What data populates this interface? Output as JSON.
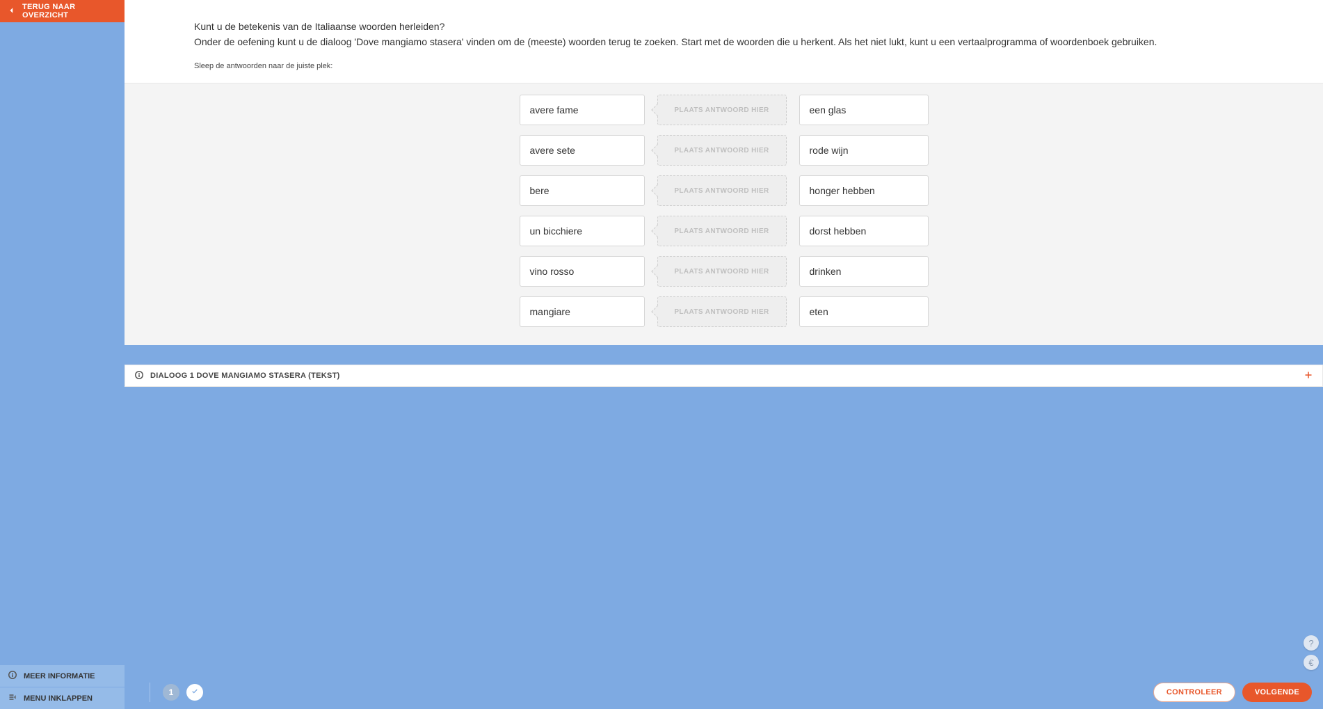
{
  "sidebar": {
    "back_label": "TERUG NAAR OVERZICHT",
    "more_info_label": "MEER INFORMATIE",
    "collapse_label": "MENU INKLAPPEN"
  },
  "intro": {
    "line1": "Kunt u de betekenis van de Italiaanse woorden herleiden?",
    "line2": "Onder de oefening kunt u de dialoog 'Dove mangiamo stasera' vinden om de (meeste) woorden terug te zoeken. Start met de woorden die u herkent. Als het niet lukt, kunt u een vertaalprogramma of woordenboek gebruiken.",
    "hint": "Sleep de antwoorden naar de juiste plek:"
  },
  "exercise": {
    "drop_placeholder": "PLAATS ANTWOORD HIER",
    "rows": [
      {
        "source": "avere fame",
        "answer": "een glas"
      },
      {
        "source": "avere sete",
        "answer": "rode wijn"
      },
      {
        "source": "bere",
        "answer": "honger hebben"
      },
      {
        "source": "un bicchiere",
        "answer": "dorst hebben"
      },
      {
        "source": "vino rosso",
        "answer": "drinken"
      },
      {
        "source": "mangiare",
        "answer": "eten"
      }
    ]
  },
  "accordion": {
    "title": "DIALOOG 1 DOVE MANGIAMO STASERA (TEKST)"
  },
  "footer": {
    "step_current": "1",
    "check_label": "CONTROLEER",
    "next_label": "VOLGENDE"
  },
  "helpers": {
    "help": "?",
    "currency": "€"
  }
}
